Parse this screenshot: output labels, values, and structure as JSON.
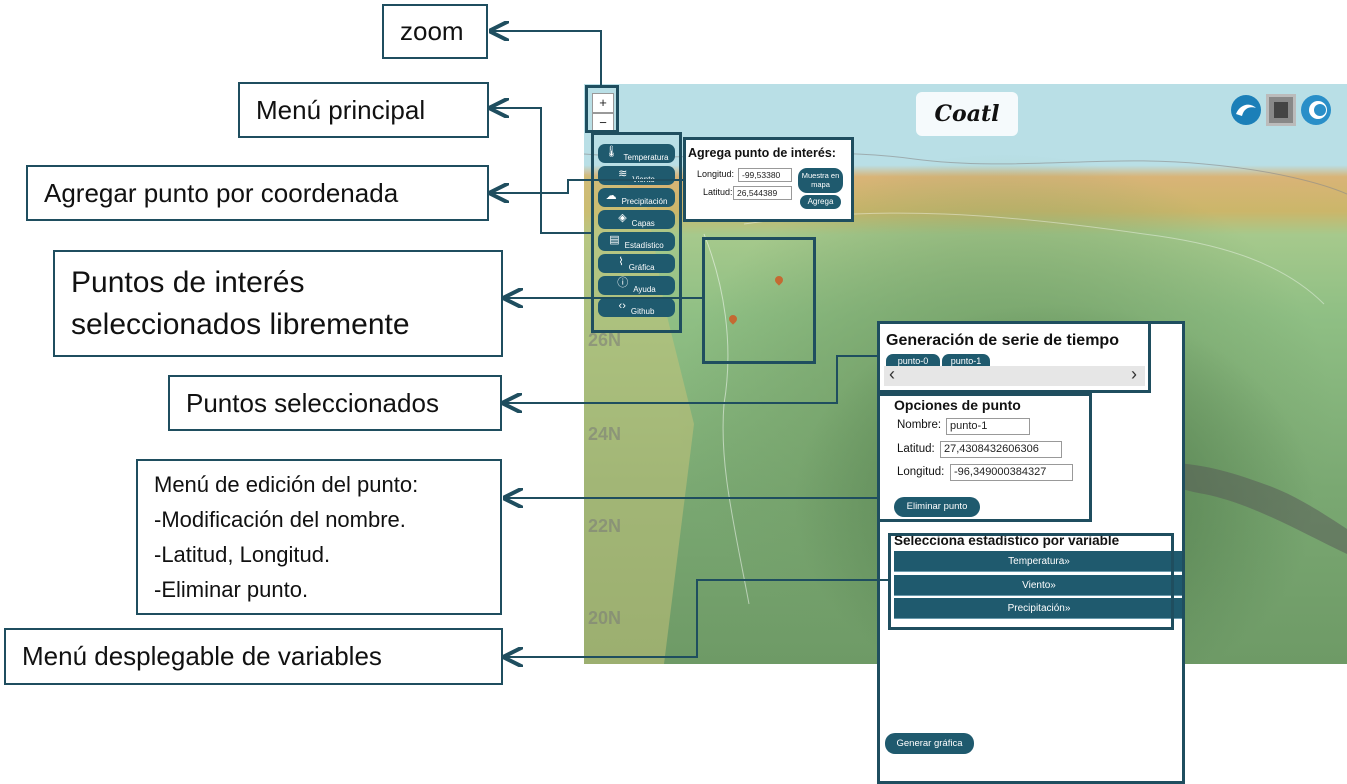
{
  "callouts": {
    "zoom": "zoom",
    "main_menu": "Menú principal",
    "add_point": "Agregar punto por coordenada",
    "points_interest_1": "Puntos de interés",
    "points_interest_2": "seleccionados libremente",
    "selected_points": "Puntos seleccionados",
    "edit_menu": [
      "Menú de edición del punto:",
      "-Modificación del nombre.",
      "-Latitud, Longitud.",
      "-Eliminar punto."
    ],
    "var_menu": "Menú desplegable de variables"
  },
  "map": {
    "title": "Coatl",
    "zoom_in": "+",
    "zoom_out": "−",
    "lat_labels": [
      "26N",
      "24N",
      "22N",
      "20N"
    ]
  },
  "main_menu": {
    "items": [
      {
        "label": "Temperatura",
        "icon": "thermometer-icon"
      },
      {
        "label": "Viento",
        "icon": "wind-icon"
      },
      {
        "label": "Precipitación",
        "icon": "rain-icon"
      },
      {
        "label": "Capas",
        "icon": "layers-icon"
      },
      {
        "label": "Estadístico",
        "icon": "statistics-icon"
      },
      {
        "label": "Gráfica",
        "icon": "chart-icon"
      },
      {
        "label": "Ayuda",
        "icon": "info-icon"
      },
      {
        "label": "Github",
        "icon": "code-icon"
      }
    ]
  },
  "add_point_panel": {
    "title": "Agrega punto de interés:",
    "longitude_label": "Longitud:",
    "longitude_value": "-99,53380",
    "latitude_label": "Latitud:",
    "latitude_value": "26,544389",
    "show_on_map": "Muestra en mapa",
    "add": "Agrega"
  },
  "series_panel": {
    "title": "Generación de serie de tiempo",
    "tabs": [
      "punto-0",
      "punto-1"
    ],
    "scroll_left": "‹",
    "scroll_right": "›"
  },
  "point_options": {
    "title": "Opciones de punto",
    "name_label": "Nombre:",
    "name_value": "punto-1",
    "lat_label": "Latitud:",
    "lat_value": "27,4308432606306",
    "lon_label": "Longitud:",
    "lon_value": "-96,349000384327",
    "delete": "Eliminar punto"
  },
  "variable_selector": {
    "title": "Selecciona estadístico por variable",
    "items": [
      "Temperatura»",
      "Viento»",
      "Precipitación»"
    ]
  },
  "generate_button": "Generar gráfica"
}
